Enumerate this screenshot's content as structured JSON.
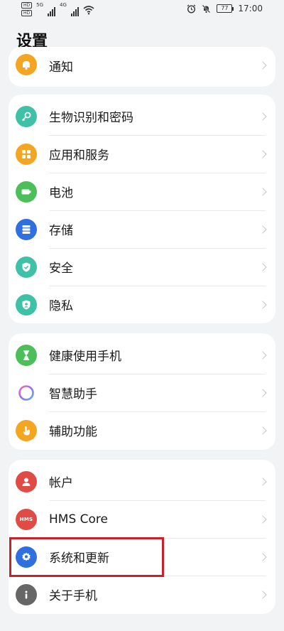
{
  "status_bar": {
    "sim1": "HD",
    "sim2": "HD",
    "network1": "5G",
    "network2": "4G",
    "battery": "77",
    "time": "17:00",
    "icons": [
      "alarm-icon",
      "mute-icon",
      "wifi-icon"
    ]
  },
  "page": {
    "title": "设置"
  },
  "groups": [
    {
      "items": [
        {
          "label": "通知",
          "icon": "bell-icon",
          "color": "#f4a623"
        }
      ]
    },
    {
      "items": [
        {
          "label": "生物识别和密码",
          "icon": "key-icon",
          "color": "#3fc1a8"
        },
        {
          "label": "应用和服务",
          "icon": "apps-icon",
          "color": "#f4a623"
        },
        {
          "label": "电池",
          "icon": "battery-icon",
          "color": "#4cbf5a"
        },
        {
          "label": "存储",
          "icon": "storage-icon",
          "color": "#2f6fe0"
        },
        {
          "label": "安全",
          "icon": "shield-icon",
          "color": "#3fc1a8"
        },
        {
          "label": "隐私",
          "icon": "privacy-icon",
          "color": "#3fc1a8"
        }
      ]
    },
    {
      "items": [
        {
          "label": "健康使用手机",
          "icon": "hourglass-icon",
          "color": "#4cbf5a"
        },
        {
          "label": "智慧助手",
          "icon": "assistant-icon",
          "color": "#b073e8"
        },
        {
          "label": "辅助功能",
          "icon": "hand-icon",
          "color": "#f4a623"
        }
      ]
    },
    {
      "items": [
        {
          "label": "帐户",
          "icon": "user-icon",
          "color": "#e04b46"
        },
        {
          "label": "HMS Core",
          "icon": "hms-icon",
          "color": "#e04b46",
          "icon_text": "HMS"
        },
        {
          "label": "系统和更新",
          "icon": "gear-icon",
          "color": "#2f6fe0"
        },
        {
          "label": "关于手机",
          "icon": "info-icon",
          "color": "#666666"
        }
      ]
    }
  ]
}
